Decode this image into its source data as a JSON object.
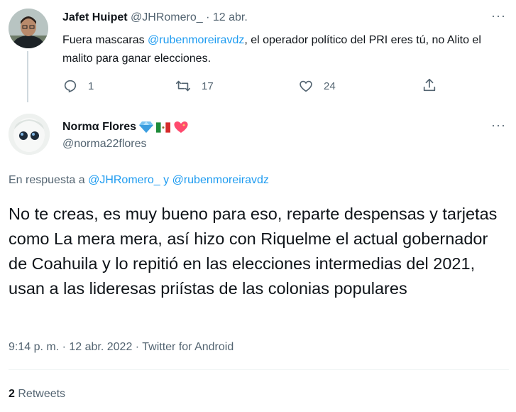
{
  "reply_tweet": {
    "author_name": "Jafet Huipet",
    "handle": "@JHRomero_",
    "separator": "·",
    "date": "12 abr.",
    "text_prefix": "Fuera mascaras ",
    "mention": "@rubenmoreiravdz",
    "text_suffix": ", el operador político del PRI eres tú, no Alito el malito para ganar elecciones.",
    "actions": {
      "reply_count": "1",
      "retweet_count": "17",
      "like_count": "24"
    }
  },
  "main_tweet": {
    "author_name": "Normα Flores",
    "emojis": [
      "gem",
      "mexico-flag",
      "heart-sparkle"
    ],
    "handle": "@norma22flores",
    "reply_prefix": "En respuesta a ",
    "reply_mention_1": "@JHRomero_",
    "reply_and": " y ",
    "reply_mention_2": "@rubenmoreiravdz",
    "text": "No te creas, es muy bueno para eso, reparte despensas y tarjetas como La mera mera, así hizo con Riquelme el actual gobernador de Coahuila y lo repitió en las elecciones intermedias del 2021, usan a las lideresas priístas de las colonias populares",
    "meta": "9:14 p. m. · 12 abr. 2022 · Twitter for Android",
    "retweets_count": "2",
    "retweets_label": "Retweets"
  },
  "colors": {
    "accent": "#1d9bf0",
    "text": "#0f1419",
    "muted": "#536471",
    "divider": "#eff3f4",
    "thread_line": "#cfd9de"
  }
}
